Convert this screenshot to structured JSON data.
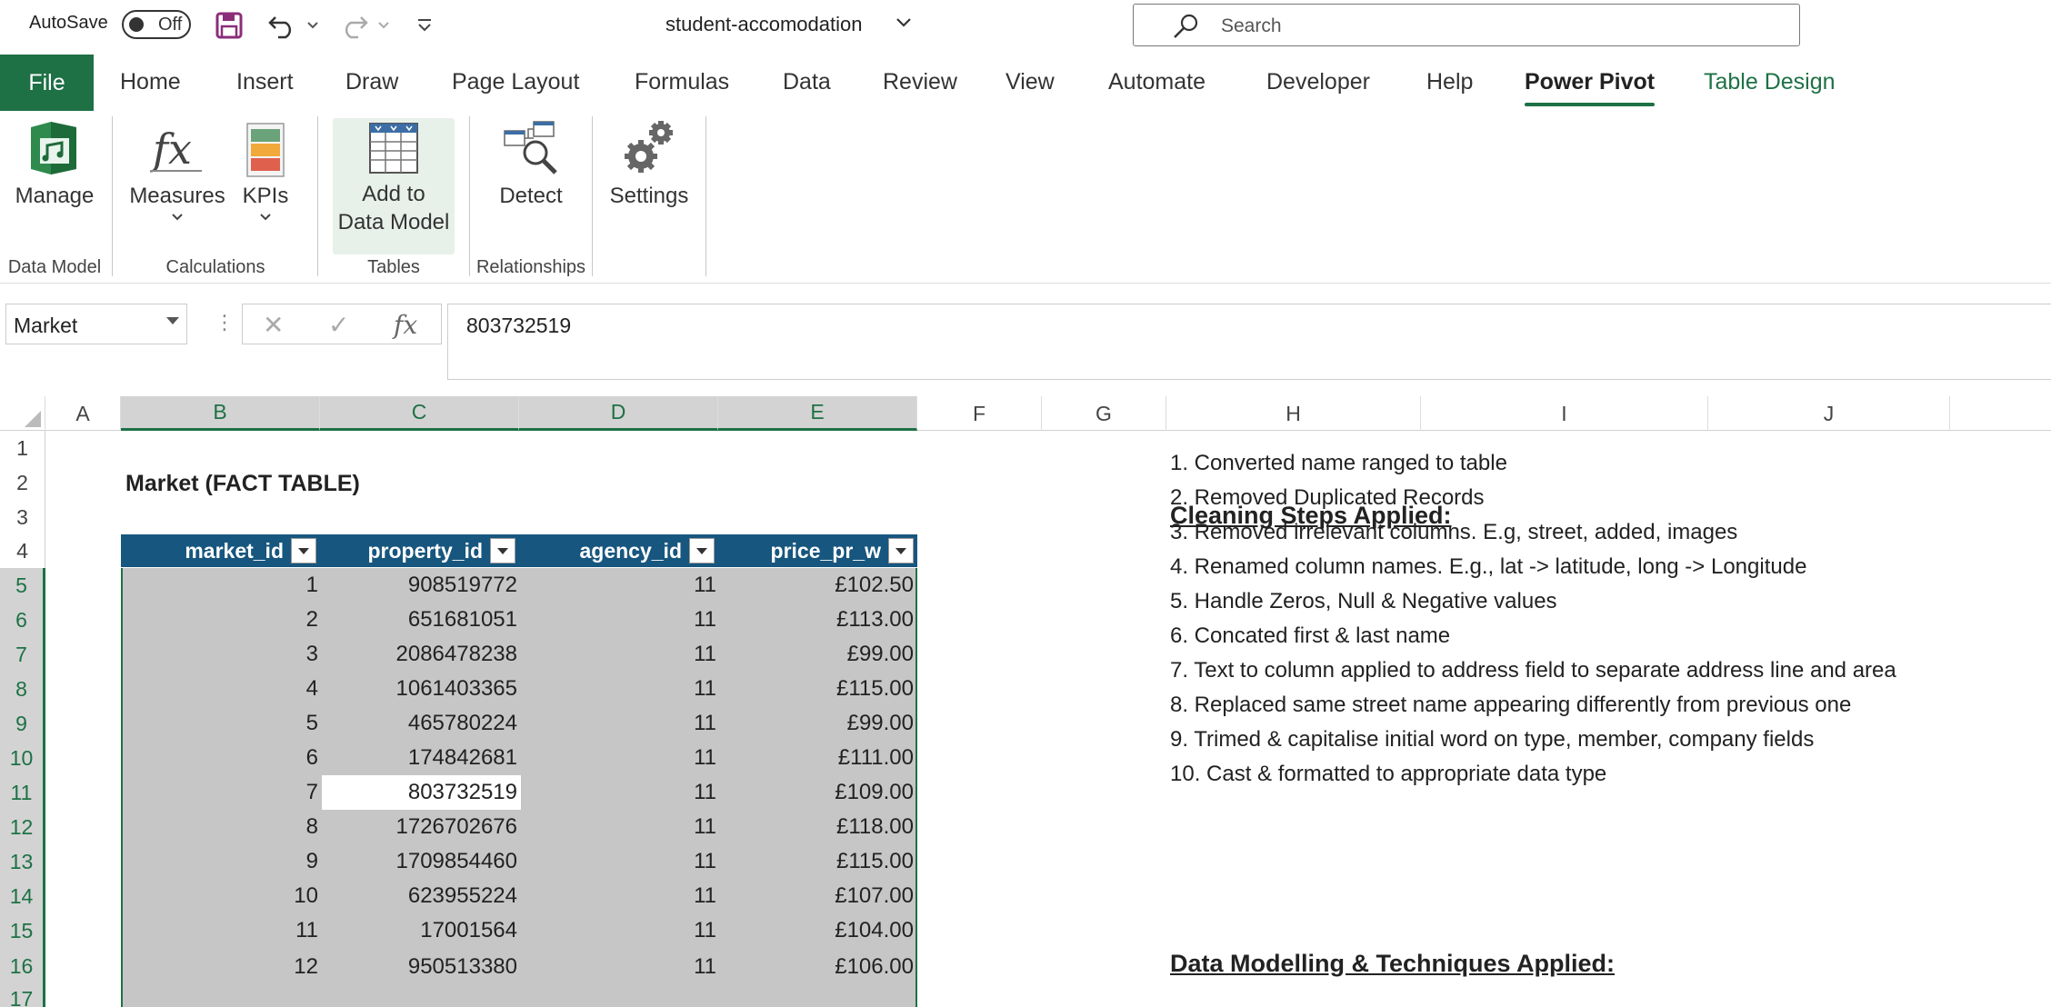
{
  "titlebar": {
    "autosave_label": "AutoSave",
    "autosave_state": "Off",
    "doc_title": "student-accomodation",
    "search_placeholder": "Search"
  },
  "tabs": {
    "file": "File",
    "items": [
      "Home",
      "Insert",
      "Draw",
      "Page Layout",
      "Formulas",
      "Data",
      "Review",
      "View",
      "Automate",
      "Developer",
      "Help",
      "Power Pivot",
      "Table Design"
    ],
    "active": "Power Pivot"
  },
  "ribbon": {
    "manage": "Manage",
    "measures": "Measures",
    "kpis": "KPIs",
    "add_to_data_model_1": "Add to",
    "add_to_data_model_2": "Data Model",
    "detect": "Detect",
    "settings": "Settings",
    "groups": {
      "data_model": "Data Model",
      "calculations": "Calculations",
      "tables": "Tables",
      "relationships": "Relationships"
    }
  },
  "formula_bar": {
    "name_box": "Market",
    "value": "803732519",
    "fx": "fx"
  },
  "grid": {
    "columns": [
      "A",
      "B",
      "C",
      "D",
      "E",
      "F",
      "G",
      "H",
      "I",
      "J"
    ],
    "rows": [
      "1",
      "2",
      "3",
      "4",
      "5",
      "6",
      "7",
      "8",
      "9",
      "10",
      "11",
      "12",
      "13",
      "14",
      "15",
      "16",
      "17"
    ],
    "selected_columns": [
      "B",
      "C",
      "D",
      "E"
    ]
  },
  "table": {
    "title": "Market (FACT TABLE)",
    "headers": [
      "market_id",
      "property_id",
      "agency_id",
      "price_pr_w"
    ],
    "rows": [
      [
        "1",
        "908519772",
        "11",
        "£102.50"
      ],
      [
        "2",
        "651681051",
        "11",
        "£113.00"
      ],
      [
        "3",
        "2086478238",
        "11",
        "£99.00"
      ],
      [
        "4",
        "1061403365",
        "11",
        "£115.00"
      ],
      [
        "5",
        "465780224",
        "11",
        "£99.00"
      ],
      [
        "6",
        "174842681",
        "11",
        "£111.00"
      ],
      [
        "7",
        "803732519",
        "11",
        "£109.00"
      ],
      [
        "8",
        "1726702676",
        "11",
        "£118.00"
      ],
      [
        "9",
        "1709854460",
        "11",
        "£115.00"
      ],
      [
        "10",
        "623955224",
        "11",
        "£107.00"
      ],
      [
        "11",
        "17001564",
        "11",
        "£104.00"
      ],
      [
        "12",
        "950513380",
        "11",
        "£106.00"
      ]
    ],
    "active_row_index": 6
  },
  "notes": {
    "cleaning_heading": "Cleaning Steps Applied:",
    "steps": [
      "1. Converted name ranged to table",
      "2. Removed Duplicated Records",
      "3. Removed irrelevant columns. E.g, street, added, images",
      "4. Renamed column names. E.g., lat -> latitude, long -> Longitude",
      "5. Handle Zeros, Null & Negative values",
      "6. Concated first & last name",
      "7. Text to column applied to address field to separate address line and area",
      "8. Replaced same street name appearing differently from previous one",
      "9. Trimed & capitalise initial word on type, member, company fields",
      "10. Cast & formatted to appropriate data type"
    ],
    "modelling_heading": "Data Modelling & Techniques Applied:"
  },
  "colors": {
    "accent": "#1e7145",
    "table_header": "#17567e",
    "selection_fill": "#c6c6c6"
  }
}
